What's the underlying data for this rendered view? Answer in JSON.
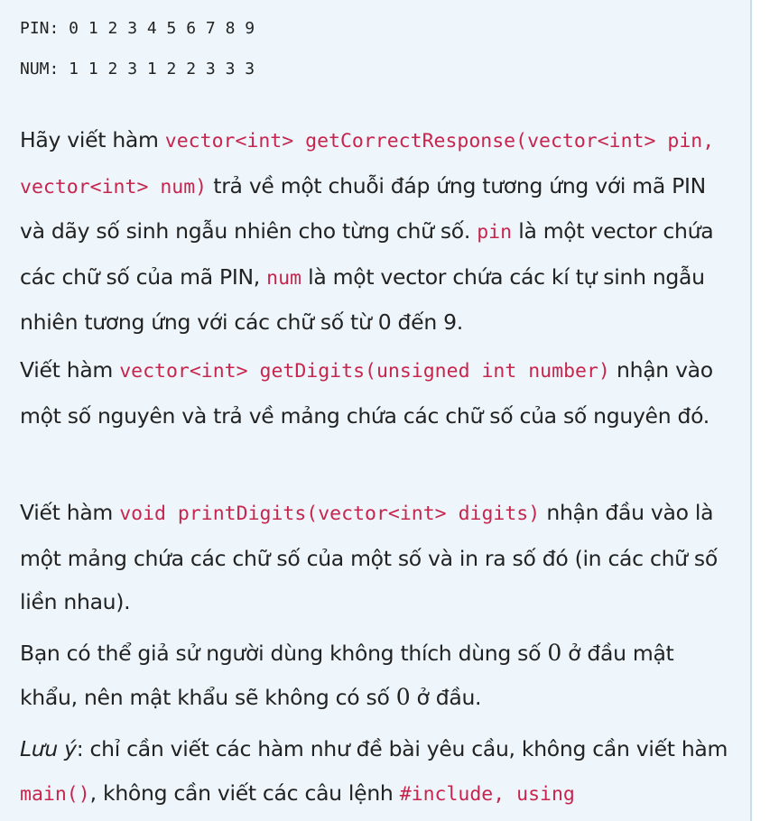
{
  "pin_line": "PIN: 0 1 2 3 4 5 6 7 8 9",
  "num_line": "NUM: 1 1 2 3 1 2 2 3 3 3",
  "p1": {
    "t1": "Hãy viết hàm ",
    "c1": "vector<int> getCorrectResponse(vector<int> pin, vector<int> num)",
    "t2": " trả về một chuỗi đáp ứng tương ứng với mã PIN và dãy số sinh ngẫu nhiên cho từng chữ số. ",
    "c2": "pin",
    "t3": " là một vector chứa các chữ số của mã PIN, ",
    "c3": "num",
    "t4": " là một vector chứa các kí tự sinh ngẫu nhiên tương ứng với các chữ số từ 0 đến 9."
  },
  "p2": {
    "t1": "Viết hàm  ",
    "c1": "vector<int> getDigits(unsigned int number)",
    "t2": " nhận vào một số nguyên và trả về mảng chứa các chữ số của số nguyên đó."
  },
  "p3": {
    "t1": "Viết hàm  ",
    "c1": "void printDigits(vector<int> digits)",
    "t2": " nhận đầu vào là một mảng chứa các chữ số của một số và in ra số đó (in các chữ số liền nhau)."
  },
  "p4": {
    "t1": "Bạn có thể giả sử người dùng không thích dùng số ",
    "m1": "0",
    "t2": " ở đầu mật khẩu, nên mật khẩu sẽ không có số ",
    "m2": "0",
    "t3": " ở đầu."
  },
  "p5": {
    "em": "Lưu ý",
    "t1": ": chỉ cần viết  các hàm như đề bài yêu cầu, không cần viết hàm ",
    "c1": "main()",
    "t2": ", không cần viết các câu lệnh ",
    "c2": "#include, using"
  }
}
